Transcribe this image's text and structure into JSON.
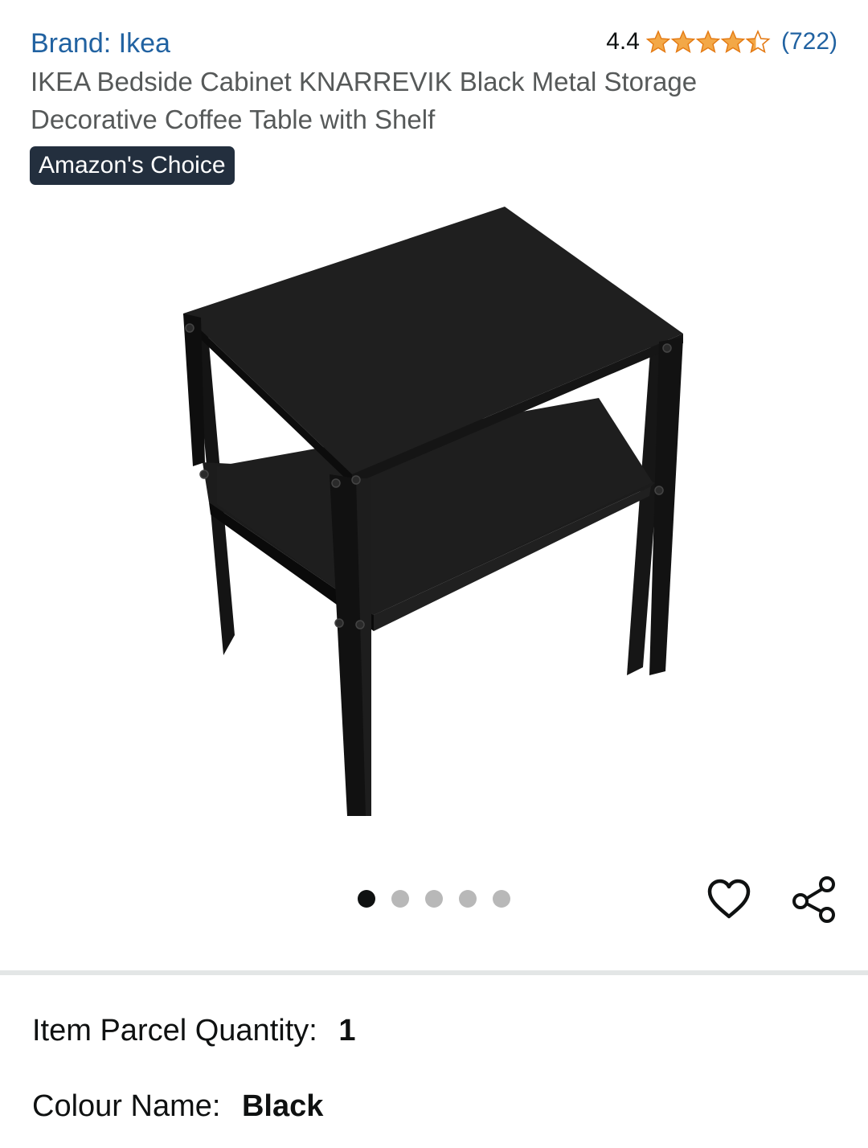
{
  "brand": {
    "label": "Brand: Ikea"
  },
  "rating": {
    "value": "4.4",
    "count": "(722)",
    "stars": 4.4,
    "star_color": "#f3a847"
  },
  "product": {
    "title": "IKEA Bedside Cabinet KNARREVIK Black Metal Storage Decorative Coffee Table with Shelf",
    "badge": "Amazon's Choice"
  },
  "carousel": {
    "total": 5,
    "active": 1
  },
  "actions": {
    "wishlist_icon": "heart-outline-icon",
    "share_icon": "share-icon"
  },
  "details": {
    "quantity_label": "Item Parcel Quantity:",
    "quantity_value": "1",
    "colour_label": "Colour Name:",
    "colour_value": "Black"
  },
  "colors": {
    "link": "#2162a1",
    "badge_bg": "#232f3e",
    "title_gray": "#565959"
  }
}
